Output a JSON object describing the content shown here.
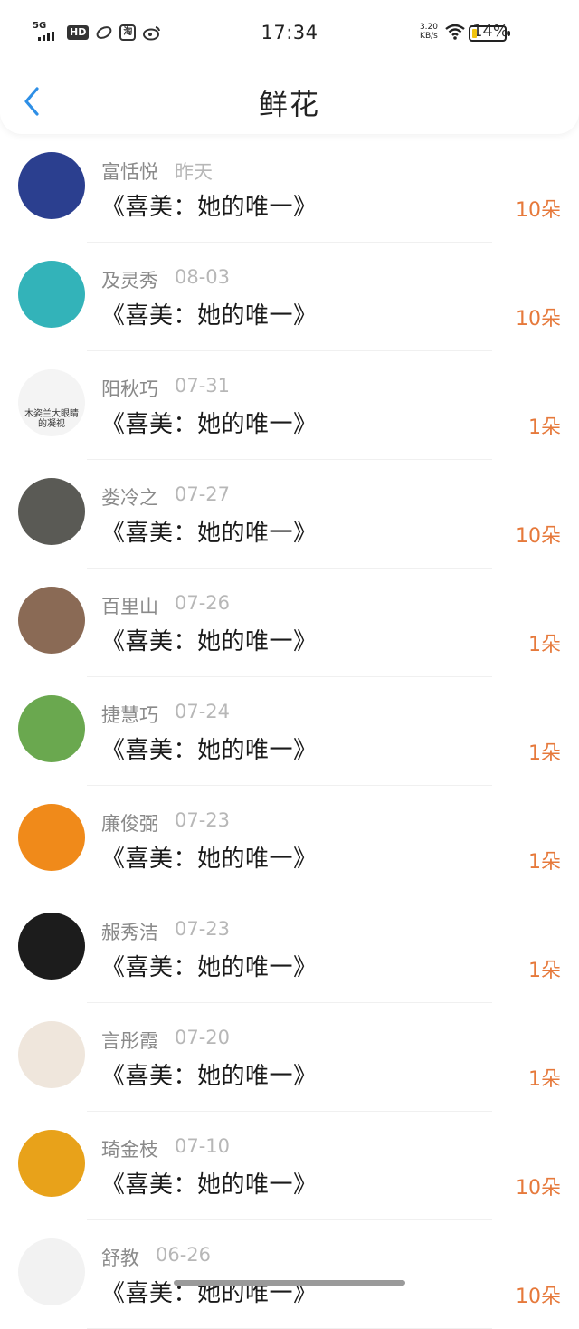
{
  "status_bar": {
    "network": "5G",
    "hd": "HD",
    "app_icon_2": "淘",
    "time": "17:34",
    "speed_value": "3.20",
    "speed_unit": "KB/s",
    "battery": "14%"
  },
  "header": {
    "title": "鲜花"
  },
  "accent_color": "#e6793b",
  "rows": [
    {
      "name": "富恬悦",
      "date": "昨天",
      "book": "《喜美：她的唯一》",
      "qty": "10朵",
      "avatar_color": "#2b3f8f"
    },
    {
      "name": "及灵秀",
      "date": "08-03",
      "book": "《喜美：她的唯一》",
      "qty": "10朵",
      "avatar_color": "#33b3b9"
    },
    {
      "name": "阳秋巧",
      "date": "07-31",
      "book": "《喜美：她的唯一》",
      "qty": "1朵",
      "avatar_color": "#f4f4f4",
      "avatar_text": "木姿兰大眼睛的凝视"
    },
    {
      "name": "娄冷之",
      "date": "07-27",
      "book": "《喜美：她的唯一》",
      "qty": "10朵",
      "avatar_color": "#5a5a55"
    },
    {
      "name": "百里山",
      "date": "07-26",
      "book": "《喜美：她的唯一》",
      "qty": "1朵",
      "avatar_color": "#8a6a55"
    },
    {
      "name": "捷慧巧",
      "date": "07-24",
      "book": "《喜美：她的唯一》",
      "qty": "1朵",
      "avatar_color": "#6aa84f"
    },
    {
      "name": "廉俊弼",
      "date": "07-23",
      "book": "《喜美：她的唯一》",
      "qty": "1朵",
      "avatar_color": "#f08a1a"
    },
    {
      "name": "赧秀洁",
      "date": "07-23",
      "book": "《喜美：她的唯一》",
      "qty": "1朵",
      "avatar_color": "#1c1c1c"
    },
    {
      "name": "言彤霞",
      "date": "07-20",
      "book": "《喜美：她的唯一》",
      "qty": "1朵",
      "avatar_color": "#efe6dc"
    },
    {
      "name": "琦金枝",
      "date": "07-10",
      "book": "《喜美：她的唯一》",
      "qty": "10朵",
      "avatar_color": "#e8a21a"
    },
    {
      "name": "舒教",
      "date": "06-26",
      "book": "《喜美：她的唯一》",
      "qty": "10朵",
      "avatar_color": "#f2f2f2"
    }
  ]
}
